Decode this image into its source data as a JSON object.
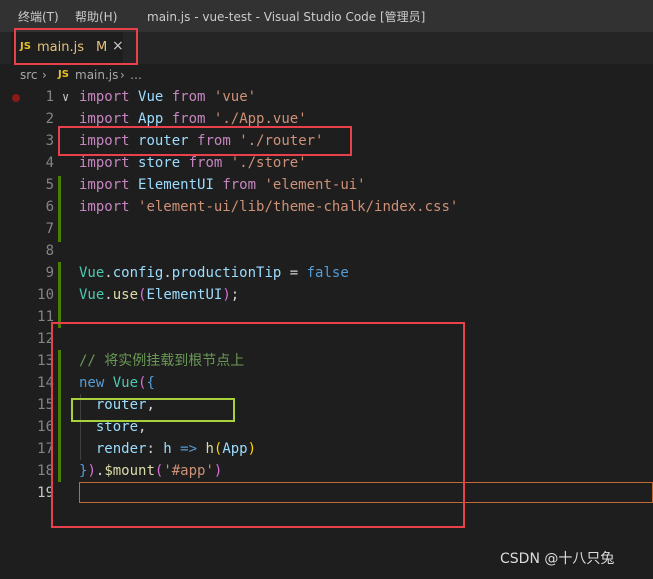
{
  "window": {
    "menu": [
      "终端(T)",
      "帮助(H)"
    ],
    "title": "main.js - vue-test - Visual Studio Code [管理员]"
  },
  "tab": {
    "badge": "JS",
    "name": "main.js",
    "modified": "M",
    "close": "×"
  },
  "breadcrumb": {
    "folder": "src",
    "sep": "›",
    "badge": "JS",
    "file": "main.js",
    "ellipsis": "…"
  },
  "editor": {
    "lines": [
      {
        "num": "1",
        "tokens": [
          {
            "t": "import",
            "c": "kw2"
          },
          {
            "t": " ",
            "c": "pun"
          },
          {
            "t": "Vue",
            "c": "id"
          },
          {
            "t": " ",
            "c": "pun"
          },
          {
            "t": "from",
            "c": "kw2"
          },
          {
            "t": " ",
            "c": "pun"
          },
          {
            "t": "'vue'",
            "c": "str"
          }
        ]
      },
      {
        "num": "2",
        "tokens": [
          {
            "t": "import",
            "c": "kw2"
          },
          {
            "t": " ",
            "c": "pun"
          },
          {
            "t": "App",
            "c": "id"
          },
          {
            "t": " ",
            "c": "pun"
          },
          {
            "t": "from",
            "c": "kw2"
          },
          {
            "t": " ",
            "c": "pun"
          },
          {
            "t": "'./App.vue'",
            "c": "str"
          }
        ]
      },
      {
        "num": "3",
        "tokens": [
          {
            "t": "import",
            "c": "kw2"
          },
          {
            "t": " ",
            "c": "pun"
          },
          {
            "t": "router",
            "c": "id"
          },
          {
            "t": " ",
            "c": "pun"
          },
          {
            "t": "from",
            "c": "kw2"
          },
          {
            "t": " ",
            "c": "pun"
          },
          {
            "t": "'./router'",
            "c": "str"
          }
        ]
      },
      {
        "num": "4",
        "tokens": [
          {
            "t": "import",
            "c": "kw2"
          },
          {
            "t": " ",
            "c": "pun"
          },
          {
            "t": "store",
            "c": "id"
          },
          {
            "t": " ",
            "c": "pun"
          },
          {
            "t": "from",
            "c": "kw2"
          },
          {
            "t": " ",
            "c": "pun"
          },
          {
            "t": "'./store'",
            "c": "str"
          }
        ]
      },
      {
        "num": "5",
        "tokens": [
          {
            "t": "import",
            "c": "kw2"
          },
          {
            "t": " ",
            "c": "pun"
          },
          {
            "t": "ElementUI",
            "c": "id"
          },
          {
            "t": " ",
            "c": "pun"
          },
          {
            "t": "from",
            "c": "kw2"
          },
          {
            "t": " ",
            "c": "pun"
          },
          {
            "t": "'element-ui'",
            "c": "str"
          }
        ]
      },
      {
        "num": "6",
        "tokens": [
          {
            "t": "import",
            "c": "kw2"
          },
          {
            "t": " ",
            "c": "pun"
          },
          {
            "t": "'element-ui/lib/theme-chalk/index.css'",
            "c": "str"
          }
        ]
      },
      {
        "num": "7",
        "tokens": []
      },
      {
        "num": "8",
        "tokens": []
      },
      {
        "num": "9",
        "tokens": [
          {
            "t": "Vue",
            "c": "cls"
          },
          {
            "t": ".",
            "c": "pun"
          },
          {
            "t": "config",
            "c": "id"
          },
          {
            "t": ".",
            "c": "pun"
          },
          {
            "t": "productionTip",
            "c": "id"
          },
          {
            "t": " = ",
            "c": "pun"
          },
          {
            "t": "false",
            "c": "kw"
          }
        ]
      },
      {
        "num": "10",
        "tokens": [
          {
            "t": "Vue",
            "c": "cls"
          },
          {
            "t": ".",
            "c": "pun"
          },
          {
            "t": "use",
            "c": "fn"
          },
          {
            "t": "(",
            "c": "brk2"
          },
          {
            "t": "ElementUI",
            "c": "id"
          },
          {
            "t": ")",
            "c": "brk2"
          },
          {
            "t": ";",
            "c": "pun"
          }
        ]
      },
      {
        "num": "11",
        "tokens": []
      },
      {
        "num": "12",
        "tokens": []
      },
      {
        "num": "13",
        "tokens": [
          {
            "t": "// 将实例挂载到根节点上",
            "c": "com"
          }
        ]
      },
      {
        "num": "14",
        "tokens": [
          {
            "t": "new",
            "c": "kw"
          },
          {
            "t": " ",
            "c": "pun"
          },
          {
            "t": "Vue",
            "c": "cls"
          },
          {
            "t": "(",
            "c": "brk2"
          },
          {
            "t": "{",
            "c": "kw"
          }
        ]
      },
      {
        "num": "15",
        "tokens": [
          {
            "t": "  router",
            "c": "id"
          },
          {
            "t": ",",
            "c": "pun"
          }
        ]
      },
      {
        "num": "16",
        "tokens": [
          {
            "t": "  store",
            "c": "id"
          },
          {
            "t": ",",
            "c": "pun"
          }
        ]
      },
      {
        "num": "17",
        "tokens": [
          {
            "t": "  render",
            "c": "id"
          },
          {
            "t": ": ",
            "c": "pun"
          },
          {
            "t": "h",
            "c": "id"
          },
          {
            "t": " => ",
            "c": "kw"
          },
          {
            "t": "h",
            "c": "fn"
          },
          {
            "t": "(",
            "c": "brk"
          },
          {
            "t": "App",
            "c": "id"
          },
          {
            "t": ")",
            "c": "brk"
          }
        ]
      },
      {
        "num": "18",
        "tokens": [
          {
            "t": "}",
            "c": "kw"
          },
          {
            "t": ")",
            "c": "brk2"
          },
          {
            "t": ".",
            "c": "pun"
          },
          {
            "t": "$mount",
            "c": "fn"
          },
          {
            "t": "(",
            "c": "brk2"
          },
          {
            "t": "'#app'",
            "c": "str"
          },
          {
            "t": ")",
            "c": "brk2"
          }
        ]
      },
      {
        "num": "19",
        "tokens": []
      }
    ]
  },
  "watermark": "CSDN @十八只兔"
}
